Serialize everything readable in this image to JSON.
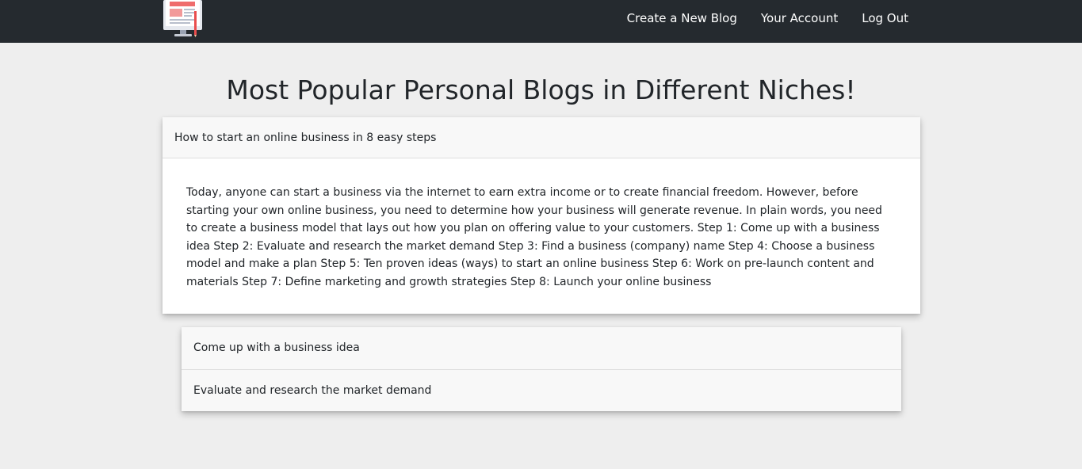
{
  "nav": {
    "logo_icon": "blog-monitor-icon",
    "links": [
      "Create a New Blog",
      "Your Account",
      "Log Out"
    ]
  },
  "page_title": "Most Popular Personal Blogs in Different Niches!",
  "featured_post": {
    "title": "How to start an online business in 8 easy steps",
    "body": "Today, anyone can start a business via the internet to earn extra income or to create financial freedom. However, before starting your own online business, you need to determine how your business will generate revenue. In plain words, you need to create a business model that lays out how you plan on offering value to your customers. Step 1: Come up with a business idea Step 2: Evaluate and research the market demand Step 3: Find a business (company) name Step 4: Choose a business model and make a plan Step 5: Ten proven ideas (ways) to start an online business Step 6: Work on pre-launch content and materials Step 7: Define marketing and growth strategies Step 8: Launch your online business"
  },
  "accordion_items": [
    "Come up with a business idea",
    "Evaluate and research the market demand"
  ],
  "colors": {
    "navbar": "#252a2f",
    "background": "#eeeeee",
    "card_header": "#f8f8f8"
  }
}
